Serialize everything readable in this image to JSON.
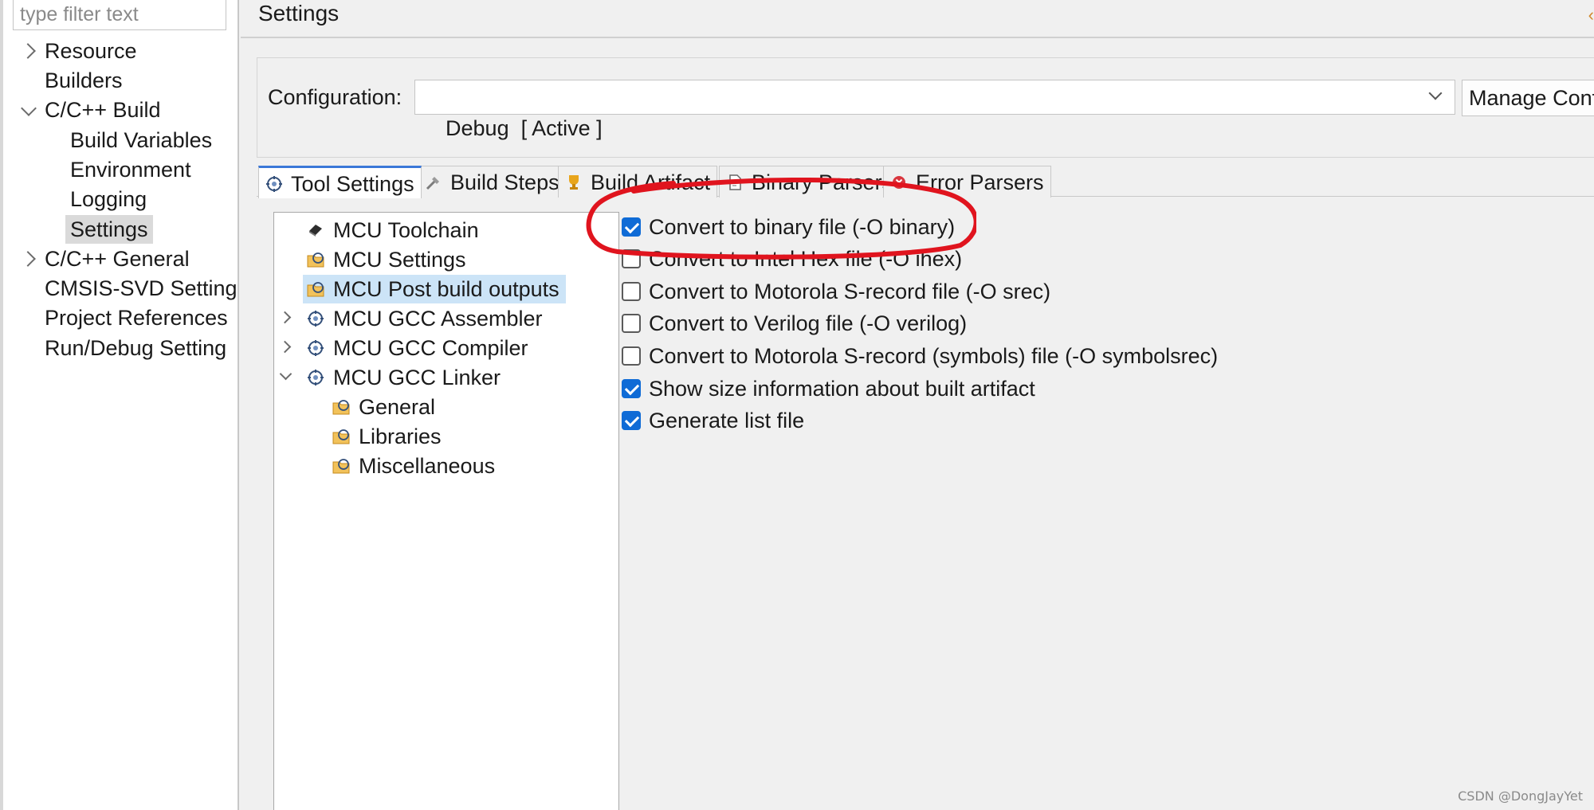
{
  "filter": {
    "placeholder": "type filter text"
  },
  "nav": {
    "items": [
      {
        "label": "Resource"
      },
      {
        "label": "Builders"
      },
      {
        "label": "C/C++ Build"
      },
      {
        "label": "Build Variables"
      },
      {
        "label": "Environment"
      },
      {
        "label": "Logging"
      },
      {
        "label": "Settings"
      },
      {
        "label": "C/C++ General"
      },
      {
        "label": "CMSIS-SVD Setting"
      },
      {
        "label": "Project References"
      },
      {
        "label": "Run/Debug Setting"
      }
    ],
    "selected": "Settings"
  },
  "header": {
    "title": "Settings"
  },
  "configuration": {
    "label": "Configuration:",
    "value": "Debug  [ Active ]",
    "manage_label": "Manage Conf"
  },
  "tabs": [
    {
      "label": "Tool Settings",
      "icon": "tool-settings-icon",
      "active": true
    },
    {
      "label": "Build Steps",
      "icon": "build-steps-icon"
    },
    {
      "label": "Build Artifact",
      "icon": "trophy-icon"
    },
    {
      "label": "Binary Parsers",
      "icon": "document-icon"
    },
    {
      "label": "Error Parsers",
      "icon": "error-icon"
    }
  ],
  "tool_tree": {
    "items": [
      {
        "label": "MCU Toolchain",
        "icon": "chip-icon"
      },
      {
        "label": "MCU Settings",
        "icon": "folder-tool-icon"
      },
      {
        "label": "MCU Post build outputs",
        "icon": "folder-tool-icon",
        "selected": true
      },
      {
        "label": "MCU GCC Assembler",
        "icon": "tool-icon"
      },
      {
        "label": "MCU GCC Compiler",
        "icon": "tool-icon"
      },
      {
        "label": "MCU GCC Linker",
        "icon": "tool-icon"
      },
      {
        "label": "General",
        "icon": "folder-tool-icon"
      },
      {
        "label": "Libraries",
        "icon": "folder-tool-icon"
      },
      {
        "label": "Miscellaneous",
        "icon": "folder-tool-icon"
      }
    ]
  },
  "options": [
    {
      "label": "Convert to binary file (-O binary)",
      "checked": true
    },
    {
      "label": "Convert to Intel Hex file (-O ihex)",
      "checked": false
    },
    {
      "label": "Convert to Motorola S-record file (-O srec)",
      "checked": false
    },
    {
      "label": "Convert to Verilog file (-O verilog)",
      "checked": false
    },
    {
      "label": "Convert to Motorola S-record (symbols) file (-O symbolsrec)",
      "checked": false
    },
    {
      "label": "Show size information about built artifact",
      "checked": true
    },
    {
      "label": "Generate list file",
      "checked": true
    }
  ],
  "colors": {
    "accent": "#0f6bd6",
    "selection": "#cce4f7",
    "annotation": "#e0141e"
  },
  "watermark": "CSDN @DongJayYet"
}
